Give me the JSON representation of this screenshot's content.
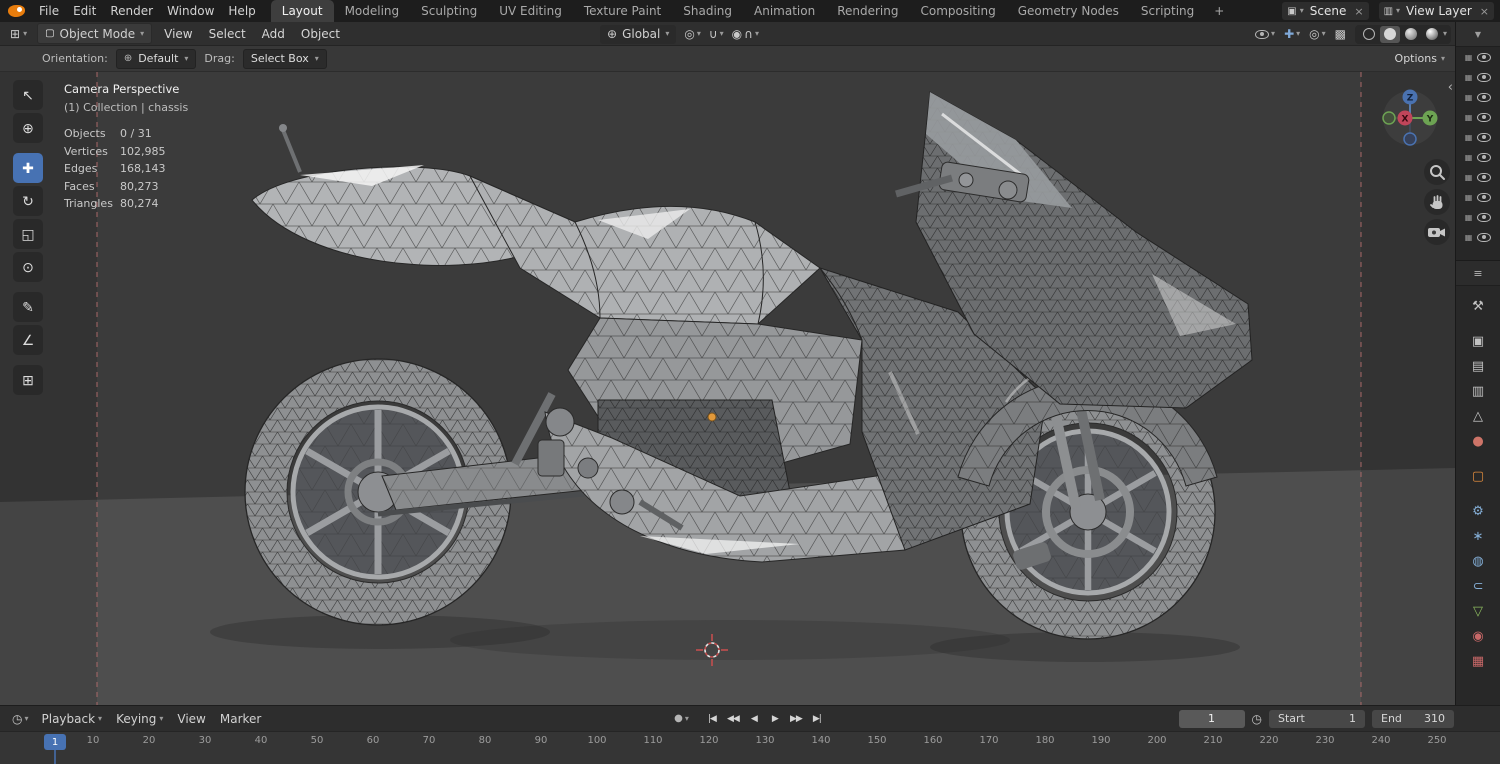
{
  "ui": {
    "caret": "▾",
    "close": "×",
    "collapse": "‹"
  },
  "topbar": {
    "app_menus": [
      "File",
      "Edit",
      "Render",
      "Window",
      "Help"
    ],
    "workspaces": [
      {
        "label": "Layout",
        "active": true
      },
      {
        "label": "Modeling"
      },
      {
        "label": "Sculpting"
      },
      {
        "label": "UV Editing"
      },
      {
        "label": "Texture Paint"
      },
      {
        "label": "Shading"
      },
      {
        "label": "Animation"
      },
      {
        "label": "Rendering"
      },
      {
        "label": "Compositing"
      },
      {
        "label": "Geometry Nodes"
      },
      {
        "label": "Scripting"
      }
    ],
    "add_workspace_label": "+",
    "scene_icon_glyph": "▣",
    "scene_name": "Scene",
    "view_layer_icon_glyph": "▥",
    "view_layer_name": "View Layer"
  },
  "header": {
    "editor_icon_glyph": "⊞",
    "mode_icon_glyph": "▢",
    "mode_label": "Object Mode",
    "menus": [
      "View",
      "Select",
      "Add",
      "Object"
    ],
    "transform": {
      "orientation_icon_glyph": "⊕",
      "orientation_label": "Global",
      "pivot_icon_glyph": "◎",
      "snap_icon_glyph": "∪",
      "proportional_icon_glyph": "◉",
      "falloff_icon_glyph": "∩"
    },
    "right": {
      "gizmo_icon_glyph": "✚",
      "overlays_icon_glyph": "◎",
      "xray_icon_glyph": "▩",
      "active_shading": "solid"
    }
  },
  "tool_settings": {
    "orientation_label": "Orientation:",
    "orientation_icon_glyph": "⊕",
    "orientation_value": "Default",
    "drag_label": "Drag:",
    "drag_value": "Select Box",
    "options_label": "Options"
  },
  "toolbar": {
    "tools": [
      {
        "name": "select-box",
        "glyph": "↖"
      },
      {
        "name": "cursor",
        "glyph": "⊕"
      },
      {
        "name": "move",
        "glyph": "✚",
        "active": true,
        "group": true
      },
      {
        "name": "rotate",
        "glyph": "↻"
      },
      {
        "name": "scale",
        "glyph": "◱"
      },
      {
        "name": "transform",
        "glyph": "⊙"
      },
      {
        "name": "annotate",
        "glyph": "✎",
        "group": true
      },
      {
        "name": "measure",
        "glyph": "∠"
      },
      {
        "name": "add-cube",
        "glyph": "⊞",
        "group": true
      }
    ]
  },
  "viewport": {
    "view_title": "Camera Perspective",
    "collection_info": "(1) Collection | chassis",
    "stats": [
      {
        "label": "Objects",
        "value": "0 / 31"
      },
      {
        "label": "Vertices",
        "value": "102,985"
      },
      {
        "label": "Edges",
        "value": "168,143"
      },
      {
        "label": "Faces",
        "value": "80,273"
      },
      {
        "label": "Triangles",
        "value": "80,274"
      }
    ],
    "gizmo_axes": {
      "x": "X",
      "y": "Y",
      "z": "Z"
    }
  },
  "outliner": {
    "filter_icon_glyph": "▼",
    "rows": [
      {
        "icon_glyph": "▦"
      },
      {
        "icon_glyph": "▦"
      },
      {
        "icon_glyph": "▦"
      },
      {
        "icon_glyph": "▦"
      },
      {
        "icon_glyph": "▦"
      },
      {
        "icon_glyph": "▦"
      },
      {
        "icon_glyph": "▦"
      },
      {
        "icon_glyph": "▦"
      },
      {
        "icon_glyph": "▦"
      },
      {
        "icon_glyph": "▦"
      }
    ]
  },
  "properties": {
    "editor_icon_glyph": "≡",
    "tabs": [
      {
        "name": "tool",
        "glyph": "⚒",
        "color": "#c2c2c2"
      },
      {
        "name": "render",
        "glyph": "▣",
        "color": "#c2c2c2",
        "group": true
      },
      {
        "name": "output",
        "glyph": "▤",
        "color": "#c2c2c2"
      },
      {
        "name": "view-layer",
        "glyph": "▥",
        "color": "#c2c2c2"
      },
      {
        "name": "scene",
        "glyph": "△",
        "color": "#c2c2c2"
      },
      {
        "name": "world",
        "glyph": "●",
        "color": "#cd7468"
      },
      {
        "name": "object",
        "glyph": "▢",
        "color": "#dd8a3d",
        "group": true
      },
      {
        "name": "modifiers",
        "glyph": "⚙",
        "color": "#84aed6",
        "group": true
      },
      {
        "name": "particles",
        "glyph": "∗",
        "color": "#84aed6"
      },
      {
        "name": "physics",
        "glyph": "◍",
        "color": "#84aed6"
      },
      {
        "name": "constraints",
        "glyph": "⊂",
        "color": "#84aed6"
      },
      {
        "name": "object-data",
        "glyph": "▽",
        "color": "#8cba5f"
      },
      {
        "name": "material",
        "glyph": "◉",
        "color": "#c96868"
      },
      {
        "name": "texture",
        "glyph": "▦",
        "color": "#c96868"
      }
    ]
  },
  "timeline": {
    "editor_icon_glyph": "◷",
    "menus": [
      {
        "label": "Playback",
        "caret_glyph": "▾"
      },
      {
        "label": "Keying",
        "caret_glyph": "▾"
      },
      {
        "label": "View"
      },
      {
        "label": "Marker"
      }
    ],
    "autokey_glyph": "●",
    "transport": [
      {
        "name": "jump-to-start",
        "glyph": "|◀"
      },
      {
        "name": "previous-keyframe",
        "glyph": "◀◀"
      },
      {
        "name": "play-reverse",
        "glyph": "◀"
      },
      {
        "name": "play",
        "glyph": "▶"
      },
      {
        "name": "next-keyframe",
        "glyph": "▶▶"
      },
      {
        "name": "jump-to-end",
        "glyph": "▶|"
      }
    ],
    "current_frame": "1",
    "clock_icon_glyph": "◷",
    "start_label": "Start",
    "start_value": "1",
    "end_label": "End",
    "end_value": "310",
    "playhead_frame": "1",
    "ruler_ticks": [
      "10",
      "20",
      "30",
      "40",
      "50",
      "60",
      "70",
      "80",
      "90",
      "100",
      "110",
      "120",
      "130",
      "140",
      "150",
      "160",
      "170",
      "180",
      "190",
      "200",
      "210",
      "220",
      "230",
      "240",
      "250"
    ]
  }
}
